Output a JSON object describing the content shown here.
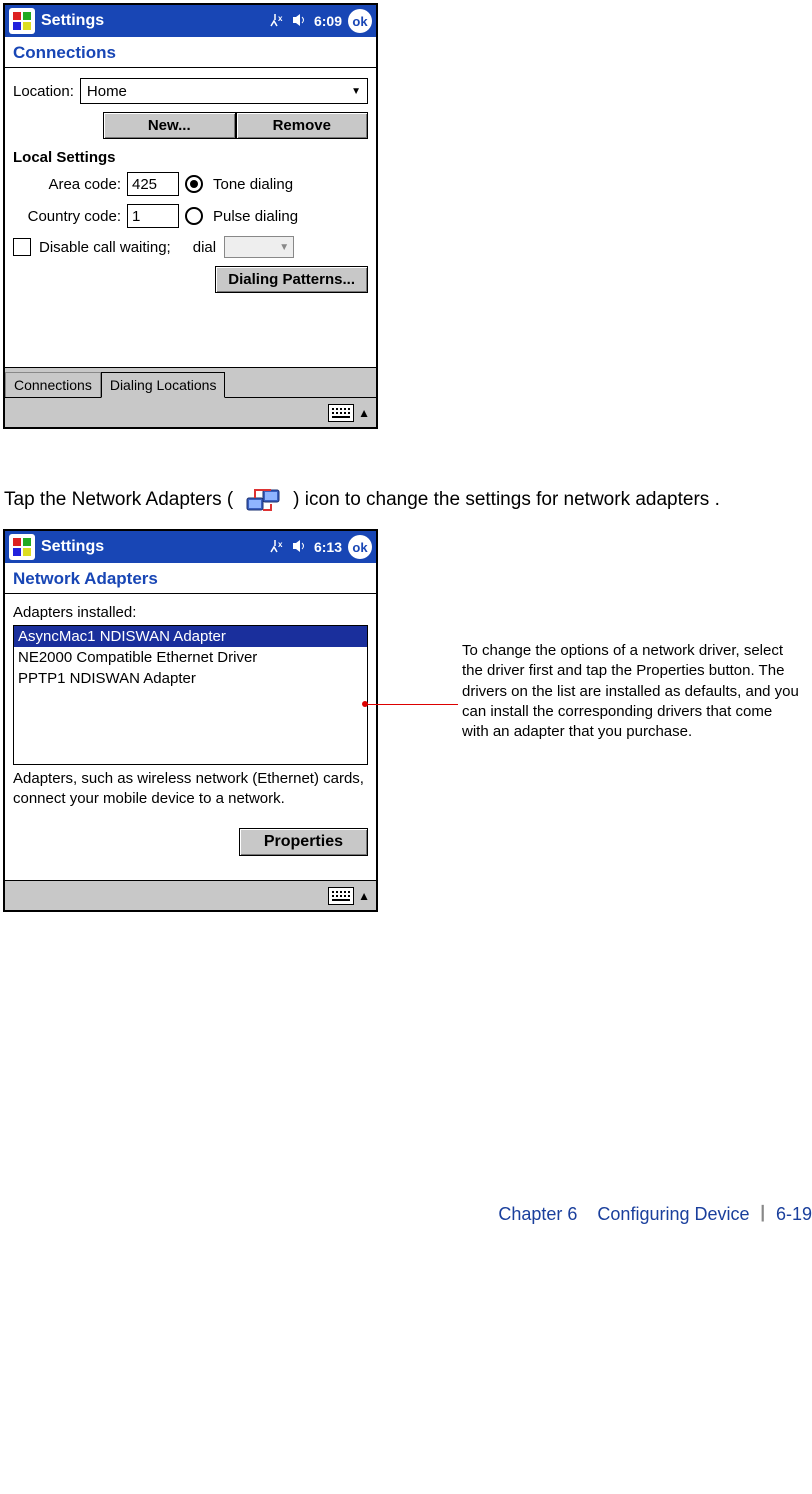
{
  "screenshot1": {
    "titlebar": {
      "title": "Settings",
      "time": "6:09",
      "ok": "ok"
    },
    "subtitle": "Connections",
    "location": {
      "label": "Location:",
      "value": "Home"
    },
    "buttons": {
      "new": "New...",
      "remove": "Remove"
    },
    "local_settings_header": "Local Settings",
    "area_code": {
      "label": "Area code:",
      "value": "425"
    },
    "country_code": {
      "label": "Country code:",
      "value": "1"
    },
    "tone_dialing": "Tone dialing",
    "pulse_dialing": "Pulse dialing",
    "disable_call_waiting": "Disable call waiting;",
    "dial_label": "dial",
    "dialing_patterns": "Dialing Patterns...",
    "tabs": {
      "connections": "Connections",
      "dialing": "Dialing Locations"
    }
  },
  "instruction": {
    "part1": "Tap the Network Adapters (",
    "part2": ") icon to change the settings for network adapters ."
  },
  "screenshot2": {
    "titlebar": {
      "title": "Settings",
      "time": "6:13",
      "ok": "ok"
    },
    "subtitle": "Network Adapters",
    "list_label": "Adapters installed:",
    "items": [
      "AsyncMac1 NDISWAN Adapter",
      "NE2000 Compatible Ethernet Driver",
      "PPTP1 NDISWAN Adapter"
    ],
    "helptext": "Adapters, such as wireless network (Ethernet) cards, connect your mobile device to a network.",
    "properties": "Properties"
  },
  "callout": "To change the options of a network driver, select the driver first and tap the Properties button. The drivers on the list are installed as defaults, and you can install the corresponding drivers that come with an adapter that you purchase.",
  "footer": {
    "chapter": "Chapter 6",
    "title": "Configuring Device",
    "page": "6-19"
  }
}
